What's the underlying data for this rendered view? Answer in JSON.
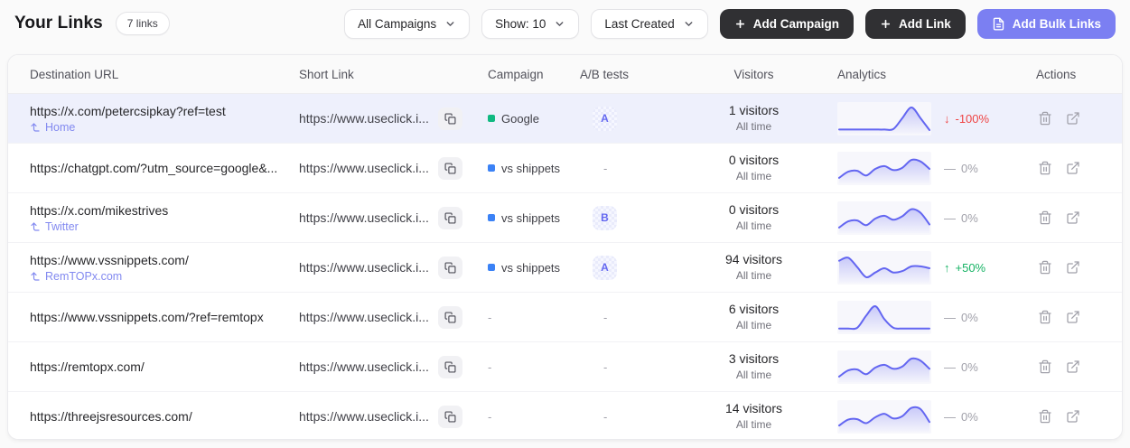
{
  "page": {
    "title": "Your Links",
    "count_badge": "7 links"
  },
  "toolbar": {
    "filters": [
      {
        "name": "campaign-filter",
        "label": "All Campaigns"
      },
      {
        "name": "show-filter",
        "label": "Show: 10"
      },
      {
        "name": "sort-filter",
        "label": "Last Created"
      }
    ],
    "add_campaign_label": "Add Campaign",
    "add_link_label": "Add Link",
    "add_bulk_label": "Add Bulk Links"
  },
  "colors": {
    "accent": "#7b7ff2",
    "dark_button": "#303033",
    "row_highlight": "#eef0fc",
    "spark_line": "#6366f1",
    "trend_down": "#ef4444",
    "trend_up": "#16b364",
    "trend_flat": "#a1a1aa"
  },
  "table": {
    "columns": [
      "Destination URL",
      "Short Link",
      "Campaign",
      "A/B tests",
      "Visitors",
      "Analytics",
      "Actions"
    ],
    "rows": [
      {
        "destination": "https://x.com/petercsipkay?ref=test",
        "page_ref": "Home",
        "short_link": "https://www.useclick.i...",
        "campaign": {
          "label": "Google",
          "color": "#10b981"
        },
        "ab_test": "A",
        "visitors": "1 visitors",
        "visitors_period": "All time",
        "trend": {
          "dir": "down",
          "label": "-100%"
        },
        "sparkline": [
          0.06,
          0.06,
          0.06,
          0.06,
          0.06,
          0.06,
          0.08,
          0.55,
          1.0,
          0.55,
          0.04
        ],
        "highlighted": true
      },
      {
        "destination": "https://chatgpt.com/?utm_source=google&...",
        "page_ref": null,
        "short_link": "https://www.useclick.i...",
        "campaign": {
          "label": "vs shippets",
          "color": "#3b82f6"
        },
        "ab_test": "-",
        "visitors": "0 visitors",
        "visitors_period": "All time",
        "trend": {
          "dir": "flat",
          "label": "0%"
        },
        "sparkline": [
          0.12,
          0.38,
          0.42,
          0.22,
          0.5,
          0.62,
          0.45,
          0.55,
          0.88,
          0.82,
          0.5
        ],
        "highlighted": false
      },
      {
        "destination": "https://x.com/mikestrives",
        "page_ref": "Twitter",
        "short_link": "https://www.useclick.i...",
        "campaign": {
          "label": "vs shippets",
          "color": "#3b82f6"
        },
        "ab_test": "B",
        "visitors": "0 visitors",
        "visitors_period": "All time",
        "trend": {
          "dir": "flat",
          "label": "0%"
        },
        "sparkline": [
          0.12,
          0.38,
          0.42,
          0.22,
          0.5,
          0.62,
          0.45,
          0.6,
          0.9,
          0.75,
          0.25
        ],
        "highlighted": false
      },
      {
        "destination": "https://www.vssnippets.com/",
        "page_ref": "RemTOPx.com",
        "short_link": "https://www.useclick.i...",
        "campaign": {
          "label": "vs shippets",
          "color": "#3b82f6"
        },
        "ab_test": "A",
        "visitors": "94 visitors",
        "visitors_period": "All time",
        "trend": {
          "dir": "up",
          "label": "+50%"
        },
        "sparkline": [
          0.82,
          0.95,
          0.55,
          0.12,
          0.32,
          0.5,
          0.32,
          0.38,
          0.58,
          0.58,
          0.5
        ],
        "highlighted": false
      },
      {
        "destination": "https://www.vssnippets.com/?ref=remtopx",
        "page_ref": null,
        "short_link": "https://www.useclick.i...",
        "campaign": null,
        "ab_test": "-",
        "visitors": "6 visitors",
        "visitors_period": "All time",
        "trend": {
          "dir": "flat",
          "label": "0%"
        },
        "sparkline": [
          0.05,
          0.05,
          0.08,
          0.6,
          1.0,
          0.45,
          0.08,
          0.05,
          0.05,
          0.05,
          0.05
        ],
        "highlighted": false
      },
      {
        "destination": "https://remtopx.com/",
        "page_ref": null,
        "short_link": "https://www.useclick.i...",
        "campaign": null,
        "ab_test": "-",
        "visitors": "3 visitors",
        "visitors_period": "All time",
        "trend": {
          "dir": "flat",
          "label": "0%"
        },
        "sparkline": [
          0.12,
          0.38,
          0.42,
          0.22,
          0.5,
          0.62,
          0.45,
          0.55,
          0.88,
          0.8,
          0.45
        ],
        "highlighted": false
      },
      {
        "destination": "https://threejsresources.com/",
        "page_ref": null,
        "short_link": "https://www.useclick.i...",
        "campaign": null,
        "ab_test": "-",
        "visitors": "14 visitors",
        "visitors_period": "All time",
        "trend": {
          "dir": "flat",
          "label": "0%"
        },
        "sparkline": [
          0.15,
          0.4,
          0.42,
          0.25,
          0.5,
          0.65,
          0.45,
          0.55,
          0.9,
          0.85,
          0.3
        ],
        "highlighted": false
      }
    ]
  }
}
